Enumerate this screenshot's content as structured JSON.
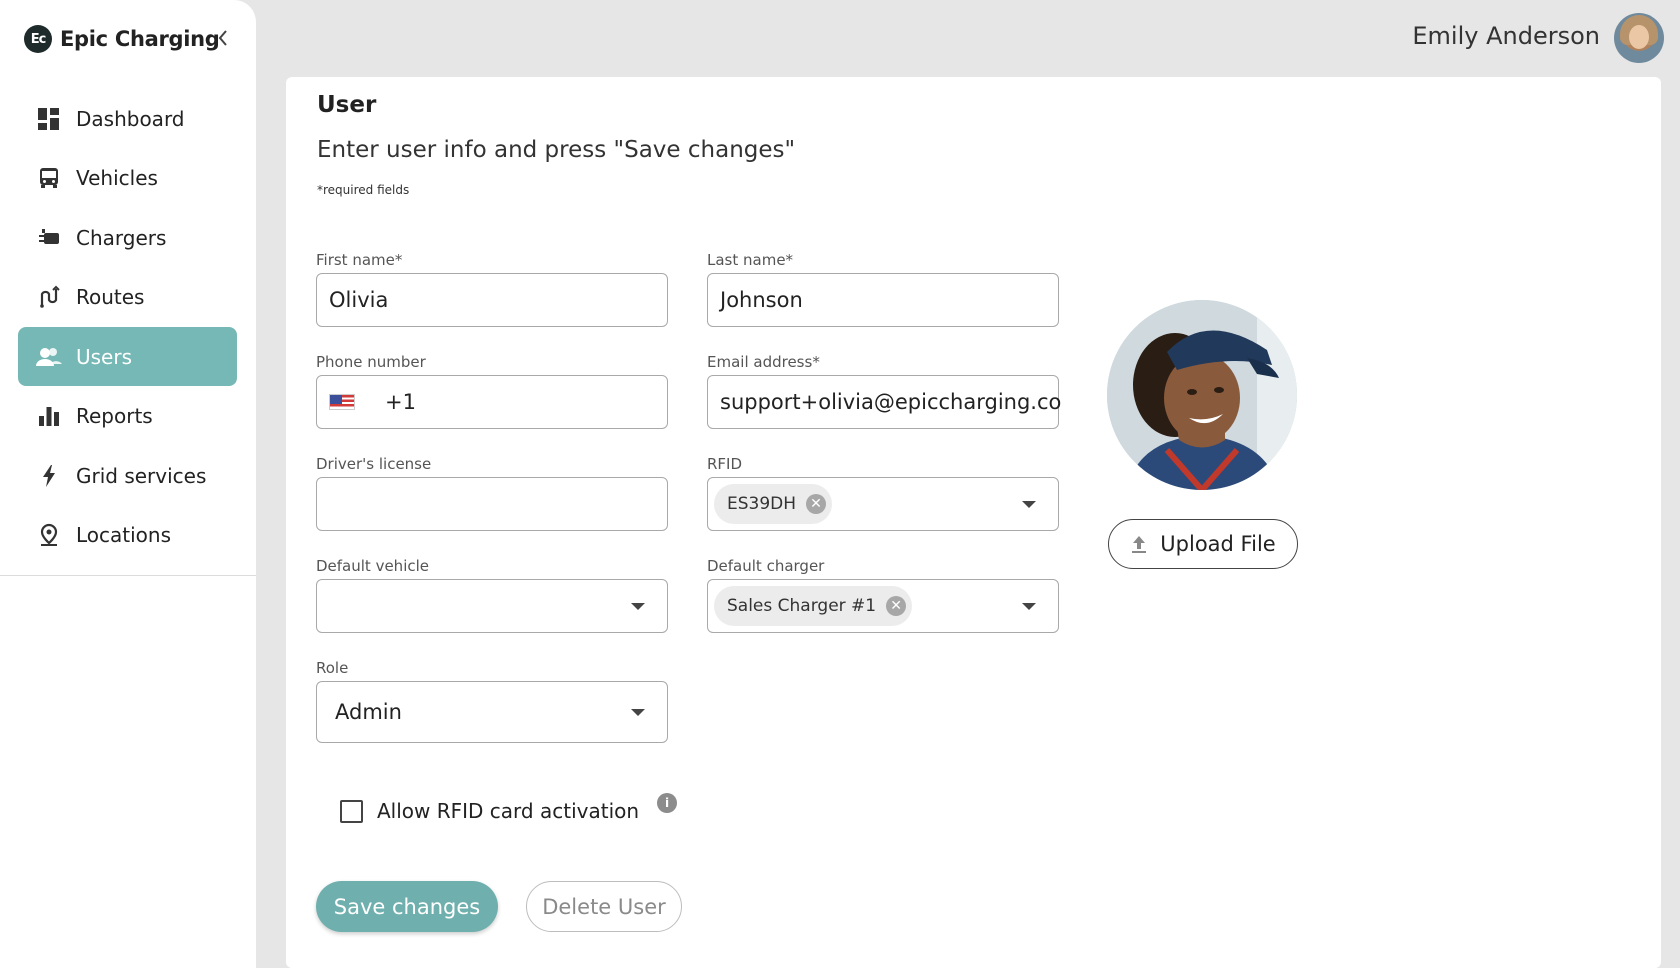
{
  "brand": {
    "logo_text": "Ec",
    "name": "Epic Charging"
  },
  "sidebar": {
    "items": [
      {
        "label": "Dashboard",
        "icon": "dashboard-icon"
      },
      {
        "label": "Vehicles",
        "icon": "bus-icon"
      },
      {
        "label": "Chargers",
        "icon": "charger-icon"
      },
      {
        "label": "Routes",
        "icon": "route-icon"
      },
      {
        "label": "Users",
        "icon": "users-icon",
        "active": true
      },
      {
        "label": "Reports",
        "icon": "bar-chart-icon"
      },
      {
        "label": "Grid services",
        "icon": "bolt-icon"
      },
      {
        "label": "Locations",
        "icon": "location-pin-icon"
      }
    ]
  },
  "header": {
    "user_name": "Emily Anderson"
  },
  "form": {
    "title": "User",
    "subtitle": "Enter user info and press \"Save changes\"",
    "required_note": "*required fields",
    "first_name": {
      "label": "First name*",
      "value": "Olivia"
    },
    "last_name": {
      "label": "Last name*",
      "value": "Johnson"
    },
    "phone": {
      "label": "Phone number",
      "country_code": "+1",
      "flag": "us-flag-icon"
    },
    "email": {
      "label": "Email address*",
      "value": "support+olivia@epiccharging.co"
    },
    "drivers_license": {
      "label": "Driver's license",
      "value": ""
    },
    "rfid": {
      "label": "RFID",
      "chip": "ES39DH"
    },
    "default_vehicle": {
      "label": "Default vehicle",
      "value": ""
    },
    "default_charger": {
      "label": "Default charger",
      "chip": "Sales Charger #1"
    },
    "role": {
      "label": "Role",
      "value": "Admin"
    },
    "rfid_activation": {
      "label": "Allow RFID card activation",
      "checked": false
    },
    "upload_label": "Upload File",
    "save_label": "Save changes",
    "delete_label": "Delete User"
  },
  "colors": {
    "accent": "#75b8b5",
    "save_button": "#6fb0ae",
    "background": "#e6e6e6"
  }
}
